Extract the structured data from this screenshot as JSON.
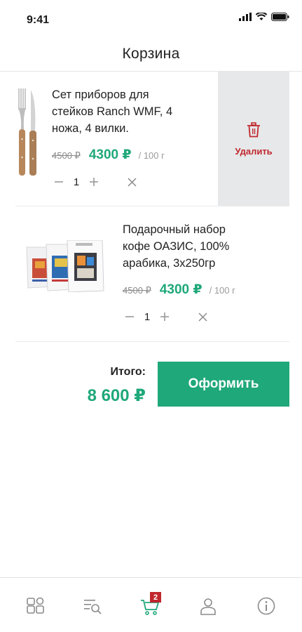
{
  "status": {
    "time": "9:41"
  },
  "header": {
    "title": "Корзина"
  },
  "items": [
    {
      "title_lines": [
        "Сет приборов для",
        "стейков Ranch WMF, 4",
        "ножа, 4 вилки."
      ],
      "old_price": "4500 ₽",
      "price": "4300 ₽",
      "unit": "/ 100 г",
      "qty": "1",
      "delete_label": "Удалить",
      "image": "knife-fork-set"
    },
    {
      "title_lines": [
        "Подарочный набор",
        "кофе ОАЗИС, 100%",
        "арабика, 3x250гр"
      ],
      "old_price": "4500 ₽",
      "price": "4300 ₽",
      "unit": "/ 100 г",
      "qty": "1",
      "image": "coffee-bags"
    }
  ],
  "summary": {
    "total_label": "Итого:",
    "total_value": "8 600 ₽",
    "checkout_label": "Оформить"
  },
  "tabbar": {
    "items": [
      {
        "icon": "catalog-icon"
      },
      {
        "icon": "search-list-icon"
      },
      {
        "icon": "cart-icon",
        "badge": "2"
      },
      {
        "icon": "profile-icon"
      },
      {
        "icon": "info-icon"
      }
    ]
  },
  "colors": {
    "accent": "#1fa879",
    "danger": "#c0272d",
    "muted": "#9a9a9a",
    "delete_bg": "#e6e8e9"
  }
}
